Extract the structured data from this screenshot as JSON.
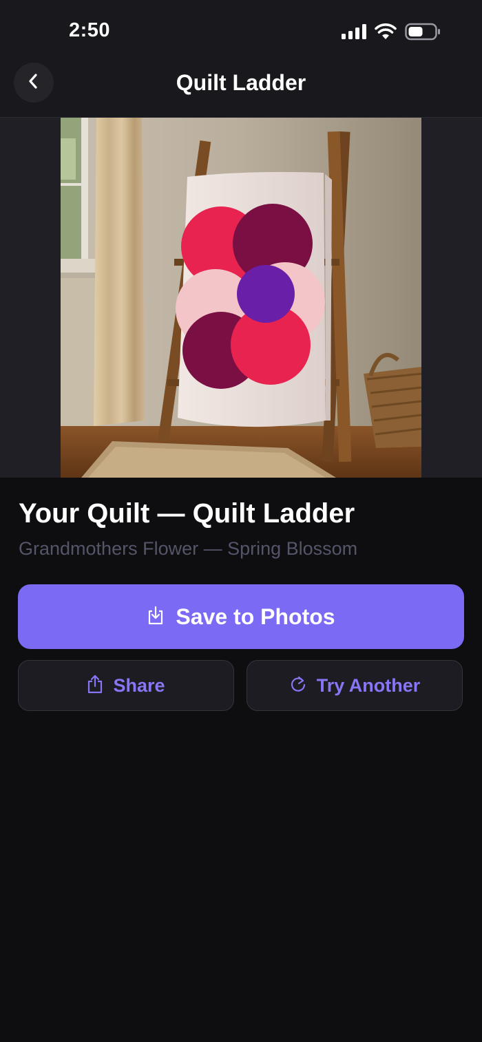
{
  "status_bar": {
    "time": "2:50",
    "icons": [
      "cellular-signal-icon",
      "wifi-icon",
      "battery-icon"
    ]
  },
  "nav": {
    "title": "Quilt Ladder",
    "back_icon": "chevron-left-icon"
  },
  "preview": {
    "subject": "quilt-ladder-mockup"
  },
  "result": {
    "title": "Your Quilt — Quilt Ladder",
    "subtitle": "Grandmothers Flower — Spring Blossom"
  },
  "actions": {
    "save_label": "Save to Photos",
    "save_icon": "save-download-icon",
    "share_label": "Share",
    "share_icon": "share-icon",
    "try_label": "Try Another",
    "try_icon": "refresh-icon"
  },
  "colors": {
    "accent": "#7b6af4",
    "accent_text": "#8776f5",
    "background": "#0e0e11",
    "header": "#18181d"
  }
}
